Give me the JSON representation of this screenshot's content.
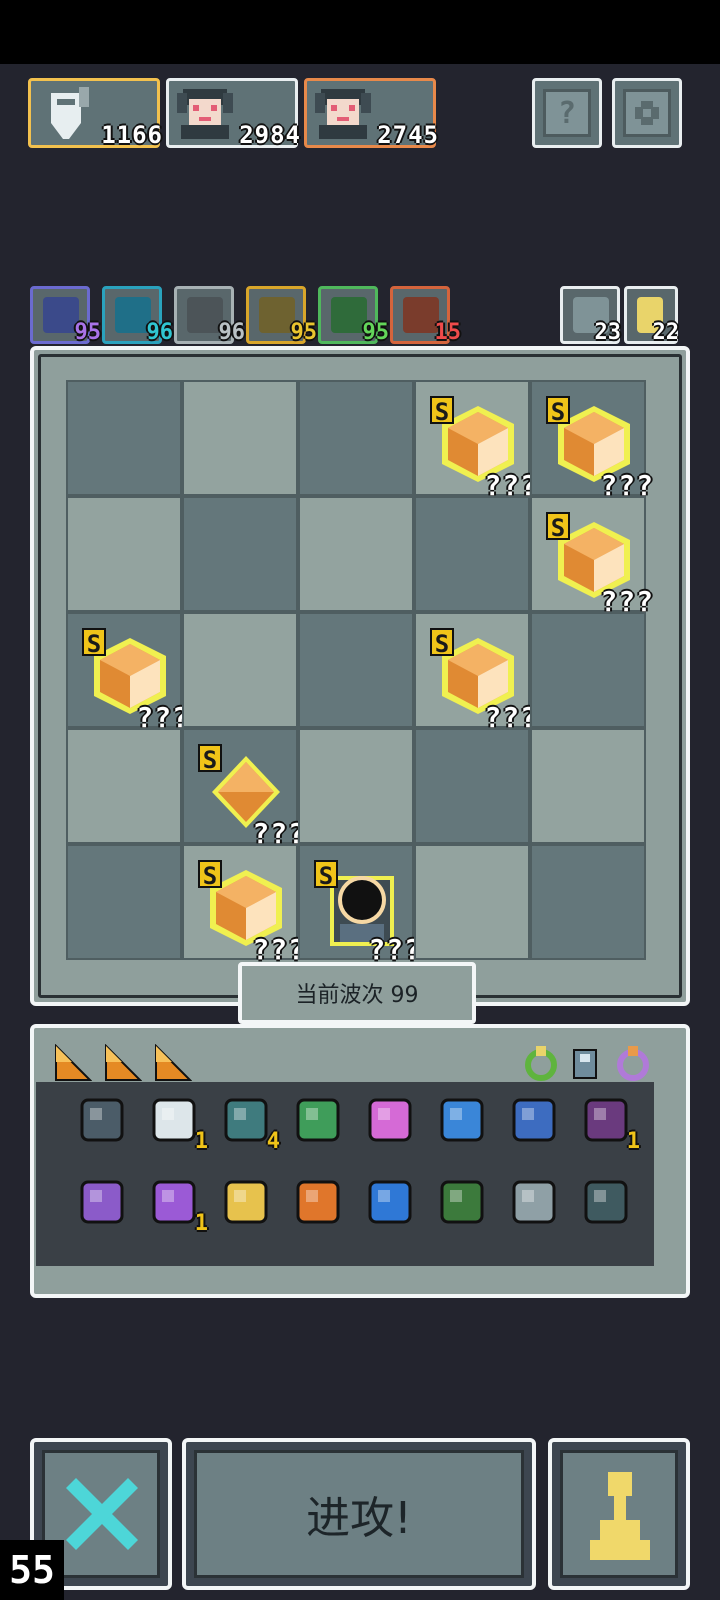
{
  "heroes": [
    {
      "value": "1166"
    },
    {
      "value": "2984"
    },
    {
      "value": "2745"
    }
  ],
  "top_buttons": {
    "help_label": "?"
  },
  "elements": [
    {
      "name": "lightning",
      "value": "95",
      "color": "#a973e8"
    },
    {
      "name": "swirl",
      "value": "96",
      "color": "#30c6d2"
    },
    {
      "name": "wind",
      "value": "96",
      "color": "#b9c1c4"
    },
    {
      "name": "boost",
      "value": "95",
      "color": "#e9c42e"
    },
    {
      "name": "poison",
      "value": "95",
      "color": "#63d65a"
    },
    {
      "name": "fire",
      "value": "15",
      "color": "#ef4b4b"
    }
  ],
  "side_counters": [
    {
      "name": "house",
      "value": "23"
    },
    {
      "name": "pawn",
      "value": "22"
    }
  ],
  "board": {
    "items": [
      {
        "row": 0,
        "col": 3,
        "rank": "S",
        "label": "???",
        "kind": "crystal"
      },
      {
        "row": 0,
        "col": 4,
        "rank": "S",
        "label": "???",
        "kind": "crystal"
      },
      {
        "row": 1,
        "col": 4,
        "rank": "S",
        "label": "???",
        "kind": "crystal"
      },
      {
        "row": 2,
        "col": 0,
        "rank": "S",
        "label": "???",
        "kind": "crystal"
      },
      {
        "row": 2,
        "col": 3,
        "rank": "S",
        "label": "???",
        "kind": "crystal"
      },
      {
        "row": 3,
        "col": 1,
        "rank": "S",
        "label": "???",
        "kind": "gem"
      },
      {
        "row": 4,
        "col": 1,
        "rank": "S",
        "label": "???",
        "kind": "crystal"
      },
      {
        "row": 4,
        "col": 2,
        "rank": "S",
        "label": "???",
        "kind": "portal"
      }
    ]
  },
  "wave": {
    "label": "当前波次 99"
  },
  "inventory": {
    "row1": [
      {
        "name": "chest-icon",
        "count": ""
      },
      {
        "name": "scroll-icon",
        "count": "1"
      },
      {
        "name": "heart-gem-icon",
        "count": "4"
      },
      {
        "name": "green-arrow-icon",
        "count": ""
      },
      {
        "name": "pink-arrow-icon",
        "count": ""
      },
      {
        "name": "water-drop-icon",
        "count": ""
      },
      {
        "name": "water-wave-icon",
        "count": ""
      },
      {
        "name": "demon-orb-icon",
        "count": "1"
      }
    ],
    "row2": [
      {
        "name": "purple-staff-icon",
        "count": ""
      },
      {
        "name": "potion-jar-icon",
        "count": "1"
      },
      {
        "name": "golden-chalice-icon",
        "count": ""
      },
      {
        "name": "fire-rune-icon",
        "count": ""
      },
      {
        "name": "water-rune-icon",
        "count": ""
      },
      {
        "name": "vine-rune-icon",
        "count": ""
      },
      {
        "name": "shuriken-icon",
        "count": ""
      },
      {
        "name": "bell-icon",
        "count": ""
      }
    ]
  },
  "attack_button": {
    "label": "进攻!"
  },
  "fps": "55"
}
